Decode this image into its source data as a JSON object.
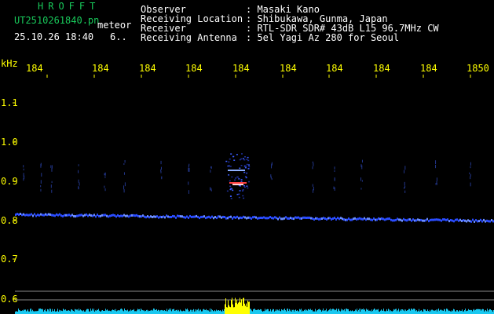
{
  "header": {
    "logo": "HROFFT",
    "filename": "UT2510261840.pn",
    "mode": "meteor",
    "datetime": "25.10.26 18:40",
    "counter": "6..",
    "info_rows": [
      {
        "label": "Observer",
        "value": ": Masaki Kano"
      },
      {
        "label": "Receiving Location",
        "value": ": Shibukawa, Gunma, Japan"
      },
      {
        "label": "Receiver",
        "value": ": RTL-SDR SDR# 43dB L15 96.7MHz CW"
      },
      {
        "label": "Receiving Antenna",
        "value": ": 5el Yagi Az 280 for Seoul"
      }
    ]
  },
  "axes": {
    "y_unit": "kHz",
    "y_ticks": [
      "1.1",
      "1.0",
      "0.9",
      "0.8",
      "0.7",
      "0.6"
    ],
    "x_ticks": [
      "184",
      "184",
      "184",
      "184",
      "184",
      "184",
      "184",
      "184",
      "184",
      "1850"
    ]
  },
  "colors": {
    "background": "#000000",
    "trace": "#2a4cff",
    "trace_highlight": "#6a8cff",
    "text_header": "#18c85a",
    "text_info": "#ffffff",
    "text_axis": "#ffff00",
    "noise_bar": "#19c8f0",
    "meteor_core": "#ff4040"
  }
}
